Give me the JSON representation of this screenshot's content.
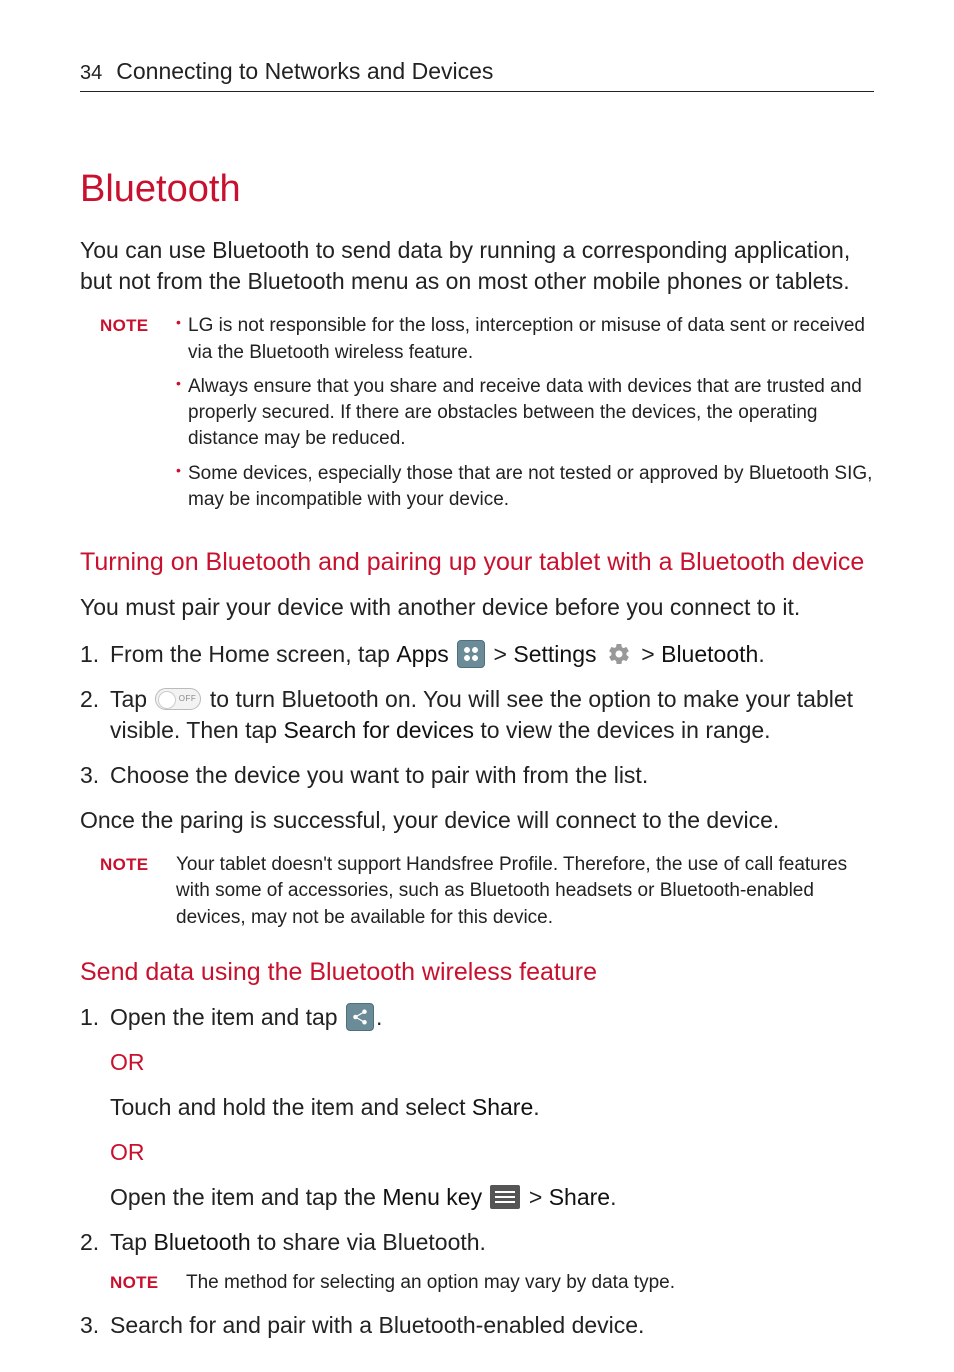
{
  "page_number": "34",
  "header_title": "Connecting to Networks and Devices",
  "section_title": "Bluetooth",
  "intro": "You can use Bluetooth to send data by running a corresponding application, but not from the Bluetooth menu as on most other mobile phones or tablets.",
  "note_label": "NOTE",
  "notes1": {
    "item1": "LG is not responsible for the loss, interception or misuse of data sent or received via the Bluetooth wireless feature.",
    "item2": "Always ensure that you share and receive data with devices that are trusted and properly secured. If there are obstacles between the devices, the operating distance may be reduced.",
    "item3": "Some devices, especially those that are not tested or approved by Bluetooth SIG, may be incompatible with your device."
  },
  "subhead1": "Turning on Bluetooth and pairing up your tablet with a Bluetooth device",
  "pair_intro": "You must pair your device with another device before you connect to it.",
  "step1": {
    "pre": "From the Home screen, tap ",
    "apps": "Apps",
    "gt1": " > ",
    "settings": "Settings",
    "gt2": " > ",
    "bluetooth": "Bluetooth",
    "period": "."
  },
  "step2": {
    "pre": "Tap ",
    "mid": " to turn Bluetooth on. You will see the option to make your tablet visible. Then tap ",
    "search": "Search for devices",
    "post": " to view the devices in range."
  },
  "step3": "Choose the device you want to pair with from the list.",
  "pair_result": "Once the paring is successful, your device will connect to the device.",
  "note2": "Your tablet doesn't support Handsfree Profile. Therefore, the use of call features with some of accessories, such as Bluetooth headsets or Bluetooth-enabled devices, may not be available for this device.",
  "subhead2": "Send data using the Bluetooth wireless feature",
  "send1": {
    "pre": "Open the item and tap ",
    "post": "."
  },
  "or": "OR",
  "send_alt1": {
    "pre": "Touch and hold the item and select ",
    "share": "Share",
    "post": "."
  },
  "send_alt2": {
    "pre": "Open the item and tap the ",
    "menu": "Menu key",
    "gt": " > ",
    "share": "Share",
    "post": "."
  },
  "send2": {
    "pre": "Tap ",
    "bt": "Bluetooth",
    "post": " to share via Bluetooth."
  },
  "note3": "The method for selecting an option may vary by data type.",
  "send3": "Search for and pair with a Bluetooth-enabled device.",
  "toggle_text": "OFF"
}
